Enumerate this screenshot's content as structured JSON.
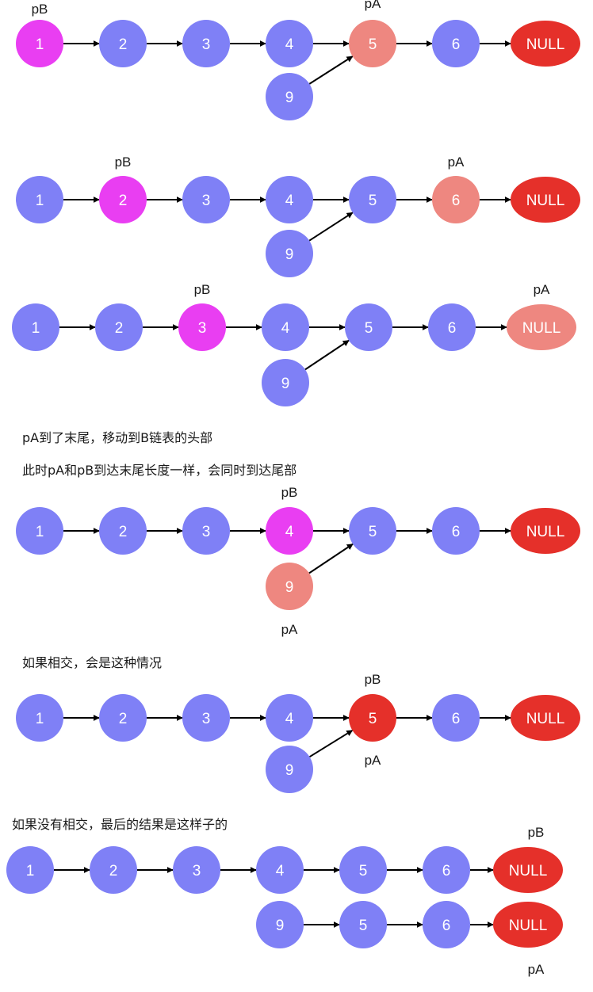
{
  "colors": {
    "node_default": "#7f80f6",
    "pointer_b": "#e93ef2",
    "pointer_a": "#ee8780",
    "null_node": "#e5302a",
    "meet_node": "#e5302a",
    "null_pointed": "#ee8780",
    "edge": "#000000"
  },
  "pointer_labels": {
    "a": "pA",
    "b": "pB"
  },
  "captions": [
    "pA到了末尾，移动到B链表的头部",
    "此时pA和pB到达末尾长度一样，会同时到达尾部",
    "如果相交，会是这种情况",
    "如果没有相交，最后的结果是这样子的"
  ],
  "steps": [
    {
      "nodes": [
        {
          "label": "1",
          "state": "pointer_b"
        },
        {
          "label": "2",
          "state": "default"
        },
        {
          "label": "3",
          "state": "default"
        },
        {
          "label": "4",
          "state": "default"
        },
        {
          "label": "5",
          "state": "pointer_a"
        },
        {
          "label": "6",
          "state": "default"
        },
        {
          "label": "NULL",
          "state": "null"
        },
        {
          "label": "9",
          "state": "default"
        }
      ]
    },
    {
      "nodes": [
        {
          "label": "1",
          "state": "default"
        },
        {
          "label": "2",
          "state": "pointer_b"
        },
        {
          "label": "3",
          "state": "default"
        },
        {
          "label": "4",
          "state": "default"
        },
        {
          "label": "5",
          "state": "default"
        },
        {
          "label": "6",
          "state": "pointer_a"
        },
        {
          "label": "NULL",
          "state": "null"
        },
        {
          "label": "9",
          "state": "default"
        }
      ]
    },
    {
      "nodes": [
        {
          "label": "1",
          "state": "default"
        },
        {
          "label": "2",
          "state": "default"
        },
        {
          "label": "3",
          "state": "pointer_b"
        },
        {
          "label": "4",
          "state": "default"
        },
        {
          "label": "5",
          "state": "default"
        },
        {
          "label": "6",
          "state": "default"
        },
        {
          "label": "NULL",
          "state": "pointed"
        },
        {
          "label": "9",
          "state": "default"
        }
      ]
    },
    {
      "nodes": [
        {
          "label": "1",
          "state": "default"
        },
        {
          "label": "2",
          "state": "default"
        },
        {
          "label": "3",
          "state": "default"
        },
        {
          "label": "4",
          "state": "pointer_b"
        },
        {
          "label": "5",
          "state": "default"
        },
        {
          "label": "6",
          "state": "default"
        },
        {
          "label": "NULL",
          "state": "null"
        },
        {
          "label": "9",
          "state": "pointer_a"
        }
      ]
    },
    {
      "nodes": [
        {
          "label": "1",
          "state": "default"
        },
        {
          "label": "2",
          "state": "default"
        },
        {
          "label": "3",
          "state": "default"
        },
        {
          "label": "4",
          "state": "default"
        },
        {
          "label": "5",
          "state": "meet"
        },
        {
          "label": "6",
          "state": "default"
        },
        {
          "label": "NULL",
          "state": "null"
        },
        {
          "label": "9",
          "state": "default"
        }
      ]
    },
    {
      "nodes": [
        {
          "label": "1",
          "state": "default"
        },
        {
          "label": "2",
          "state": "default"
        },
        {
          "label": "3",
          "state": "default"
        },
        {
          "label": "4",
          "state": "default"
        },
        {
          "label": "5",
          "state": "default"
        },
        {
          "label": "6",
          "state": "default"
        },
        {
          "label": "NULL",
          "state": "null"
        },
        {
          "label": "9",
          "state": "default"
        },
        {
          "label": "5",
          "state": "default"
        },
        {
          "label": "6",
          "state": "default"
        },
        {
          "label": "NULL",
          "state": "null"
        }
      ]
    }
  ]
}
